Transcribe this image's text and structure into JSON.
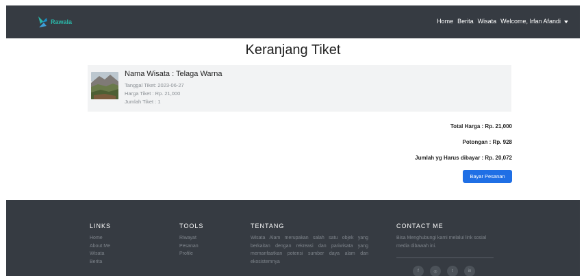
{
  "navbar": {
    "brand": "Rawala",
    "links": [
      "Home",
      "Berita",
      "Wisata"
    ],
    "user_menu": "Welcome, Irfan Afandi"
  },
  "page": {
    "title": "Keranjang Tiket"
  },
  "cart": {
    "items": [
      {
        "name": "Nama Wisata : Telaga Warna",
        "date": "Tanggal Tiket: 2023-06-27",
        "price": "Harga Tiket : Rp. 21,000",
        "quantity": "Jumlah Tiket : 1"
      }
    ]
  },
  "summary": {
    "total": "Total Harga : Rp. 21,000",
    "discount": "Potongan : Rp. 928",
    "due": "Jumlah yg Harus dibayar : Rp. 20,072",
    "pay_button": "Bayar Pesanan"
  },
  "footer": {
    "links": {
      "heading": "LINKS",
      "items": [
        "Home",
        "About Me",
        "Wisata",
        "Berita"
      ]
    },
    "tools": {
      "heading": "TOOLS",
      "items": [
        "Riwayat",
        "Pesanan",
        "Profile"
      ]
    },
    "about": {
      "heading": "TENTANG",
      "text": "Wisata Alam merupakan salah satu objek yang berkaitan dengan rekreasi dan pariwisata yang memanfaatkan potensi sumber daya alam dan ekosistemnya"
    },
    "contact": {
      "heading": "CONTACT ME",
      "text": "Bisa Menghubungi kami melalui link sosial media dibawah ini.",
      "socials": [
        "facebook-icon",
        "instagram-icon",
        "twitter-icon",
        "linkedin-icon"
      ]
    }
  },
  "colors": {
    "navbar_bg": "#363b42",
    "brand_accent": "#2bb6a8",
    "button_primary": "#1f6fe5",
    "card_bg": "#f2f3f4"
  }
}
